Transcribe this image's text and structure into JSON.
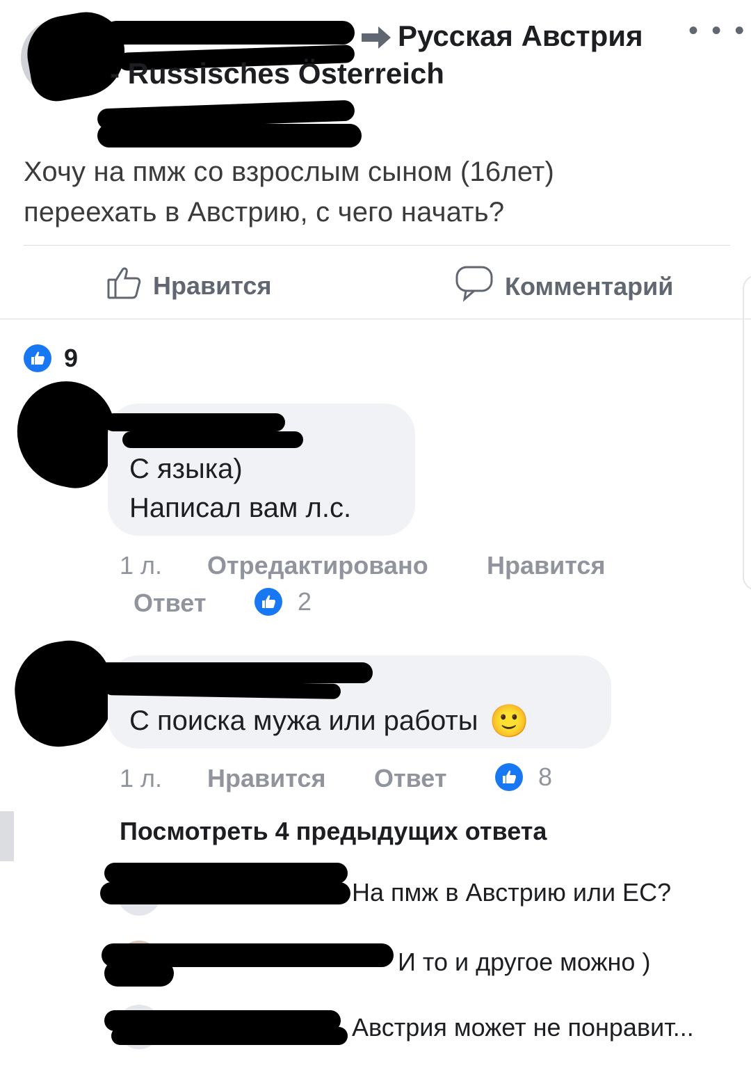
{
  "post": {
    "group_name": "Русская Австрия - Russisches Österreich",
    "group_line1": "Русская Австрия",
    "group_line2": "- Russisches Österreich",
    "text_line1": "Хочу на пмж со взрослым сыном (16лет)",
    "text_line2": "переехать в Австрию, с чего начать?",
    "menu_icon": "more-dots-icon"
  },
  "actions": {
    "like_label": "Нравится",
    "comment_label": "Комментарий"
  },
  "reactions": {
    "count": "9"
  },
  "comments": [
    {
      "text_line1": "С языка)",
      "text_line2": "Написал вам л.с.",
      "time": "1 л.",
      "edited": "Отредактировано",
      "like": "Нравится",
      "reply": "Ответ",
      "likes": "2"
    },
    {
      "text_line1": "С поиска мужа или работы",
      "emoji": "🙂",
      "time": "1 л.",
      "like": "Нравится",
      "reply": "Ответ",
      "likes": "8"
    }
  ],
  "replies": {
    "view_previous": "Посмотреть 4 предыдущих ответа",
    "items": [
      "На пмж в Австрию или ЕС?",
      "И то и другое можно )",
      "Австрия может не понравит..."
    ]
  },
  "colors": {
    "accent": "#1877f2",
    "meta_gray": "#90949c",
    "bubble": "#f0f2f5"
  }
}
